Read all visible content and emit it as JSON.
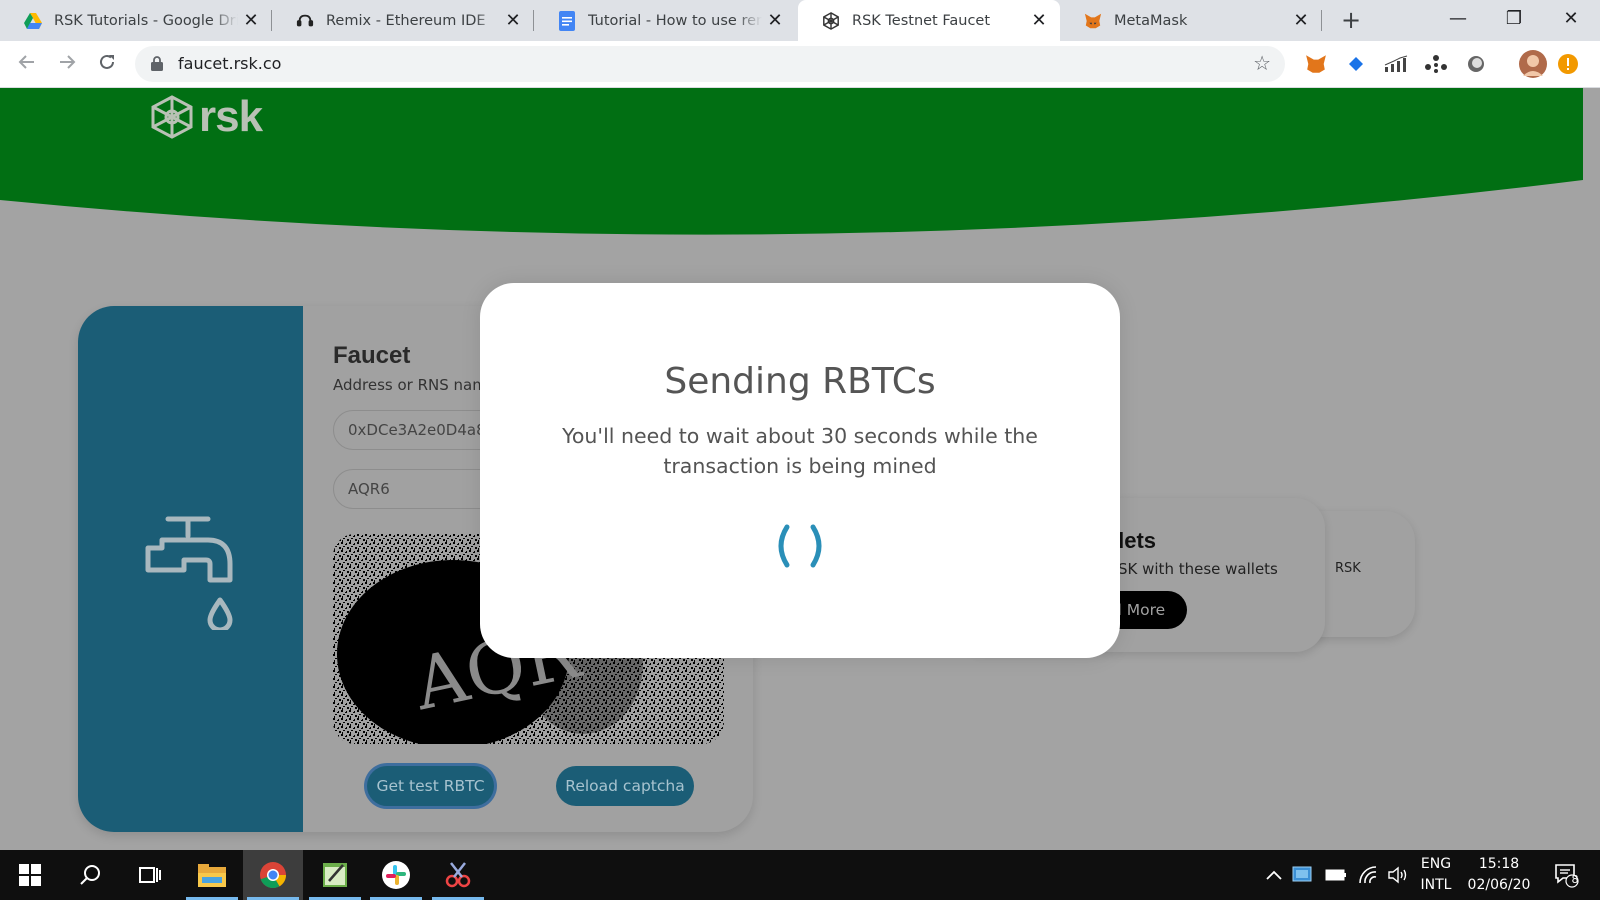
{
  "browser": {
    "tabs": [
      {
        "title": "RSK Tutorials - Google Drive",
        "icon": "google-drive-icon",
        "active": false
      },
      {
        "title": "Remix - Ethereum IDE",
        "icon": "remix-icon",
        "active": false
      },
      {
        "title": "Tutorial - How to use remix",
        "icon": "google-docs-icon",
        "active": false
      },
      {
        "title": "RSK Testnet Faucet",
        "icon": "rsk-icon",
        "active": true
      },
      {
        "title": "MetaMask",
        "icon": "metamask-icon",
        "active": false
      }
    ],
    "close_glyph": "✕",
    "new_tab_glyph": "+",
    "window_controls": {
      "minimize": "—",
      "restore": "❐",
      "close": "✕"
    },
    "url": "faucet.rsk.co",
    "extensions": [
      "metamask-icon",
      "blue-diamond-icon",
      "signal-chart-icon",
      "network-dots-icon",
      "circle-extension-icon",
      "profile-avatar",
      "update-alert-icon"
    ]
  },
  "page": {
    "logo_text": "rsk",
    "brand_colors": {
      "header_green": "#016f13",
      "panel_teal": "#1b5d76"
    },
    "faucet": {
      "title": "Faucet",
      "subtitle": "Address or RNS name",
      "address_value": "0xDCe3A2e0D4a8",
      "captcha_value": "AQR6",
      "get_button": "Get test RBTC",
      "reload_button": "Reload captcha"
    },
    "wallets": {
      "title": "llets",
      "subtitle": "SK with these wallets",
      "read_more": "d More",
      "back_card_text": "RSK"
    }
  },
  "modal": {
    "title": "Sending RBTCs",
    "text": "You'll need to wait about 30 seconds while the transaction is being mined"
  },
  "taskbar": {
    "apps": [
      "windows-start-icon",
      "search-icon",
      "task-view-icon",
      "file-explorer-icon",
      "chrome-icon",
      "notepad-icon",
      "slack-icon",
      "snipping-icon"
    ],
    "language_1": "ENG",
    "language_2": "INTL",
    "time": "15:18",
    "date": "02/06/20",
    "notification_count": "8"
  }
}
